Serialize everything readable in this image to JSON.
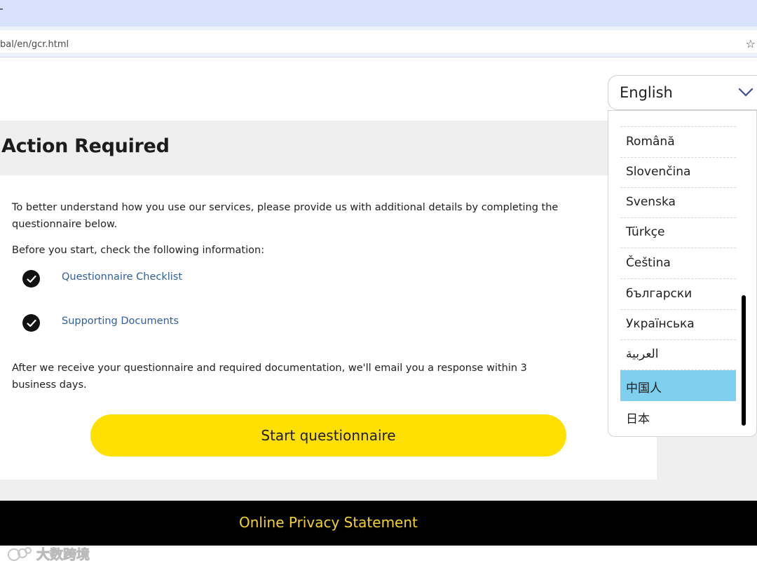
{
  "browser": {
    "url": "bal/en/gcr.html"
  },
  "language_select": {
    "value": "English",
    "options": [
      "Română",
      "Slovenčina",
      "Svenska",
      "Türkçe",
      "Čeština",
      "български",
      "Українська",
      "العربية",
      "中国人",
      "日本"
    ],
    "highlighted": "中国人"
  },
  "page": {
    "title": "Action Required",
    "intro": "To better understand how you use our services, please provide us with additional details by completing the questionnaire below.",
    "before_label": "Before you start, check the following information:",
    "checklist": [
      {
        "label": "Questionnaire Checklist"
      },
      {
        "label": "Supporting Documents"
      }
    ],
    "after_text": "After we receive your questionnaire and required documentation, we'll email you a response within 3 business days.",
    "start_button": "Start questionnaire"
  },
  "footer": {
    "link": "Online Privacy Statement"
  },
  "watermark": {
    "text": "大数跨境"
  },
  "colors": {
    "accent_yellow": "#FFE000",
    "footer_link": "#F4D22C",
    "link_blue": "#2F5F9A",
    "highlight": "#7ECFF0"
  }
}
